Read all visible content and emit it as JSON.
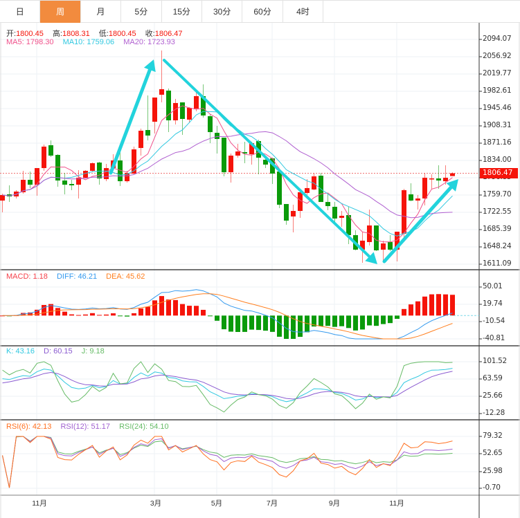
{
  "tabs": [
    {
      "label": "日",
      "active": false
    },
    {
      "label": "周",
      "active": true
    },
    {
      "label": "月",
      "active": false
    },
    {
      "label": "5分",
      "active": false
    },
    {
      "label": "15分",
      "active": false
    },
    {
      "label": "30分",
      "active": false
    },
    {
      "label": "60分",
      "active": false
    },
    {
      "label": "4时",
      "active": false
    }
  ],
  "ohlc_legend": {
    "open_label": "开:",
    "open": "1800.45",
    "high_label": "高:",
    "high": "1808.31",
    "low_label": "低:",
    "low": "1800.45",
    "close_label": "收:",
    "close": "1806.47"
  },
  "ma_legend": {
    "ma5": "MA5: 1798.30",
    "ma10": "MA10: 1759.06",
    "ma20": "MA20: 1723.93"
  },
  "macd_legend": {
    "macd": "MACD: 1.18",
    "diff": "DIFF: 46.21",
    "dea": "DEA: 45.62"
  },
  "kdj_legend": {
    "k": "K: 43.16",
    "d": "D: 60.15",
    "j": "J: 9.18"
  },
  "rsi_legend": {
    "rsi6": "RSI(6): 42.13",
    "rsi12": "RSI(12): 51.17",
    "rsi24": "RSI(24): 54.10"
  },
  "current_price": "1806.47",
  "axes": {
    "price_ticks": [
      "2094.07",
      "2056.92",
      "2019.77",
      "1982.61",
      "1945.46",
      "1908.31",
      "1871.16",
      "1834.00",
      "1796.85",
      "1759.70",
      "1722.55",
      "1685.39",
      "1648.24",
      "1611.09"
    ],
    "macd_ticks": [
      "50.01",
      "19.74",
      "-10.54",
      "-40.81"
    ],
    "kdj_ticks": [
      "101.52",
      "63.59",
      "25.66",
      "-12.28"
    ],
    "rsi_ticks": [
      "79.32",
      "52.65",
      "25.98",
      "-0.70"
    ],
    "x_labels": [
      "11月",
      "3月",
      "5月",
      "7月",
      "9月",
      "11月"
    ]
  },
  "colors": {
    "up": "#f5140a",
    "down": "#0a9a0a",
    "ma5": "#f0508a",
    "ma10": "#30c8e0",
    "ma20": "#b060d0",
    "diff": "#3399ee",
    "dea": "#ff7f1e",
    "k": "#30c8e0",
    "d": "#8a5ad0",
    "j": "#66bb66",
    "rsi6": "#ff7020",
    "rsi12": "#a060d0",
    "rsi24": "#66bb66",
    "arrow": "#22d3dc",
    "active_tab": "#f28b3e"
  },
  "chart_data": {
    "type": "candlestick",
    "ylim": [
      1611.09,
      2094.07
    ],
    "columns": [
      "open",
      "close",
      "high",
      "low"
    ],
    "candles": [
      [
        1747.8,
        1759.7,
        1762.7,
        1722.5
      ],
      [
        1761.2,
        1756.7,
        1780.5,
        1744.8
      ],
      [
        1756.7,
        1767.1,
        1770.1,
        1752.3
      ],
      [
        1765.6,
        1792.4,
        1811.7,
        1762.7
      ],
      [
        1792.4,
        1781.9,
        1810.2,
        1774.6
      ],
      [
        1781.9,
        1817.6,
        1817.6,
        1758.2
      ],
      [
        1817.6,
        1863.7,
        1868.2,
        1811.7
      ],
      [
        1866.7,
        1844.4,
        1877.1,
        1841.4
      ],
      [
        1845.9,
        1790.9,
        1847.4,
        1777.5
      ],
      [
        1790.9,
        1781.9,
        1807.2,
        1761.2
      ],
      [
        1783.5,
        1780.5,
        1792.4,
        1770.1
      ],
      [
        1781.9,
        1796.8,
        1813.2,
        1752.3
      ],
      [
        1796.8,
        1811.7,
        1813.2,
        1795.4
      ],
      [
        1811.7,
        1828.1,
        1829.5,
        1810.2
      ],
      [
        1829.5,
        1795.4,
        1831.0,
        1781.9
      ],
      [
        1793.9,
        1817.6,
        1826.6,
        1789.4
      ],
      [
        1817.6,
        1834.0,
        1847.4,
        1814.7
      ],
      [
        1834.0,
        1789.4,
        1851.8,
        1779.0
      ],
      [
        1789.4,
        1807.2,
        1811.7,
        1786.4
      ],
      [
        1805.8,
        1857.8,
        1863.7,
        1804.3
      ],
      [
        1860.8,
        1897.9,
        1902.4,
        1844.4
      ],
      [
        1899.4,
        1887.5,
        1973.7,
        1877.1
      ],
      [
        1917.2,
        1969.2,
        1969.2,
        1892.0
      ],
      [
        1975.2,
        1987.1,
        2070.3,
        1958.8
      ],
      [
        1984.1,
        1920.2,
        1988.6,
        1894.9
      ],
      [
        1920.2,
        1957.4,
        1966.3,
        1911.3
      ],
      [
        1958.8,
        1923.2,
        1958.8,
        1889.0
      ],
      [
        1921.7,
        1947.0,
        1948.4,
        1915.7
      ],
      [
        1945.5,
        1972.2,
        1981.1,
        1939.5
      ],
      [
        1972.2,
        1930.6,
        1997.5,
        1926.1
      ],
      [
        1929.1,
        1894.9,
        1933.6,
        1871.2
      ],
      [
        1893.4,
        1880.1,
        1908.3,
        1848.9
      ],
      [
        1883.0,
        1808.7,
        1883.0,
        1799.8
      ],
      [
        1808.7,
        1844.4,
        1848.9,
        1786.4
      ],
      [
        1844.4,
        1853.3,
        1869.7,
        1839.9
      ],
      [
        1851.8,
        1848.9,
        1874.1,
        1828.1
      ],
      [
        1847.4,
        1871.2,
        1874.1,
        1825.1
      ],
      [
        1875.6,
        1839.9,
        1878.6,
        1804.3
      ],
      [
        1835.5,
        1825.1,
        1839.9,
        1817.6
      ],
      [
        1838.5,
        1805.8,
        1839.9,
        1783.5
      ],
      [
        1810.2,
        1738.9,
        1810.2,
        1731.4
      ],
      [
        1740.4,
        1704.7,
        1740.4,
        1695.8
      ],
      [
        1713.6,
        1725.5,
        1738.9,
        1679.4
      ],
      [
        1725.5,
        1765.6,
        1767.1,
        1710.6
      ],
      [
        1764.1,
        1774.6,
        1793.9,
        1759.7
      ],
      [
        1771.6,
        1799.8,
        1807.2,
        1770.1
      ],
      [
        1801.3,
        1744.8,
        1807.2,
        1744.8
      ],
      [
        1744.8,
        1735.9,
        1764.1,
        1727.0
      ],
      [
        1734.4,
        1709.2,
        1744.8,
        1700.2
      ],
      [
        1710.6,
        1715.1,
        1725.5,
        1691.3
      ],
      [
        1716.6,
        1673.5,
        1734.4,
        1654.2
      ],
      [
        1673.5,
        1642.3,
        1683.9,
        1640.8
      ],
      [
        1642.3,
        1661.6,
        1680.9,
        1614.0
      ],
      [
        1658.6,
        1694.3,
        1728.5,
        1651.2
      ],
      [
        1694.3,
        1640.8,
        1694.3,
        1639.3
      ],
      [
        1642.3,
        1655.7,
        1661.6,
        1617.0
      ],
      [
        1658.6,
        1642.3,
        1673.5,
        1639.3
      ],
      [
        1642.3,
        1680.9,
        1680.9,
        1617.0
      ],
      [
        1676.5,
        1770.1,
        1773.1,
        1666.1
      ],
      [
        1761.2,
        1747.8,
        1784.9,
        1746.3
      ],
      [
        1747.8,
        1752.3,
        1759.7,
        1728.5
      ],
      [
        1752.3,
        1796.8,
        1807.2,
        1737.4
      ],
      [
        1793.9,
        1795.4,
        1804.3,
        1773.1
      ],
      [
        1795.4,
        1790.9,
        1823.6,
        1773.1
      ],
      [
        1789.4,
        1796.8,
        1823.6,
        1781.9
      ],
      [
        1800.45,
        1806.47,
        1808.31,
        1800.45
      ]
    ],
    "macd_range": [
      -40.81,
      50.01
    ],
    "kdj_range": [
      -12.28,
      101.52
    ],
    "rsi_range": [
      -0.7,
      79.32
    ]
  }
}
